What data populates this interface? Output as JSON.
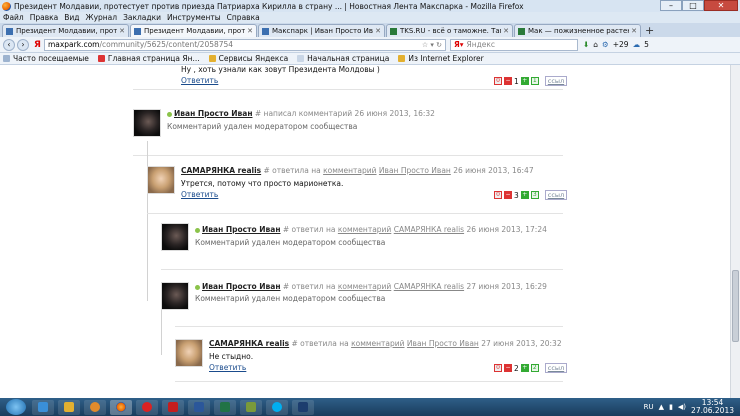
{
  "window": {
    "title": "Президент Молдавии, протестует против приезда Патриарха Кирилла в страну ... | Новостная Лента Макспарка - Mozilla Firefox",
    "min": "–",
    "max": "□",
    "close": "✕"
  },
  "menu": [
    "Файл",
    "Правка",
    "Вид",
    "Журнал",
    "Закладки",
    "Инструменты",
    "Справка"
  ],
  "tabs": [
    {
      "label": "Президент Молдавии, протестует п...",
      "active": false
    },
    {
      "label": "Президент Молдавии, протестует п...",
      "active": true
    },
    {
      "label": "Макспарк | Иван Просто Иван",
      "active": false
    },
    {
      "label": "TKS.RU - всё о таможне. Таможня д...",
      "active": false
    },
    {
      "label": "Мак — пожизненное растение - ТК...",
      "active": false
    }
  ],
  "newtab": "+",
  "nav": {
    "yandex": "Я",
    "url_host": "maxpark.com",
    "url_path": "/community/5625/content/2058754",
    "search_placeholder": "Яндекс",
    "counter": "+29",
    "weather": "5"
  },
  "bookmarks": [
    "Часто посещаемые",
    "Главная страница Ян...",
    "Сервисы Яндекса",
    "Начальная страница",
    "Из Internet Explorer"
  ],
  "comments": {
    "c0": {
      "text": "Ну , хоть узнали как зовут Президента Молдовы )",
      "reply": "Ответить",
      "minus": "0",
      "score": "1",
      "plus": "1",
      "link": "ссыл"
    },
    "c1": {
      "author": "Иван Просто Иван",
      "meta": "# написал комментарий 26 июня 2013, 16:32",
      "text": "Комментарий удален модератором сообщества"
    },
    "c2": {
      "author": "САМАРЯНКА realis",
      "meta_pre": "# ответила на",
      "meta_link1": "комментарий",
      "meta_link2": "Иван Просто Иван",
      "meta_date": "26 июня 2013, 16:47",
      "text": "Утрется, потому что просто марионетка.",
      "reply": "Ответить",
      "minus": "0",
      "score": "3",
      "plus": "3",
      "link": "ссыл"
    },
    "c3": {
      "author": "Иван Просто Иван",
      "meta_pre": "# ответил на",
      "meta_link1": "комментарий",
      "meta_link2": "САМАРЯНКА realis",
      "meta_date": "26 июня 2013, 17:24",
      "text": "Комментарий удален модератором сообщества"
    },
    "c4": {
      "author": "Иван Просто Иван",
      "meta_pre": "# ответил на",
      "meta_link1": "комментарий",
      "meta_link2": "САМАРЯНКА realis",
      "meta_date": "27 июня 2013, 16:29",
      "text": "Комментарий удален модератором сообщества"
    },
    "c5": {
      "author": "САМАРЯНКА realis",
      "meta_pre": "# ответила на",
      "meta_link1": "комментарий",
      "meta_link2": "Иван Просто Иван",
      "meta_date": "27 июня 2013, 20:32",
      "text": "Не стыдно.",
      "reply": "Ответить",
      "minus": "0",
      "score": "2",
      "plus": "2",
      "link": "ссыл"
    }
  },
  "taskbar": {
    "lang": "RU",
    "time": "13:54",
    "date": "27.06.2013"
  }
}
